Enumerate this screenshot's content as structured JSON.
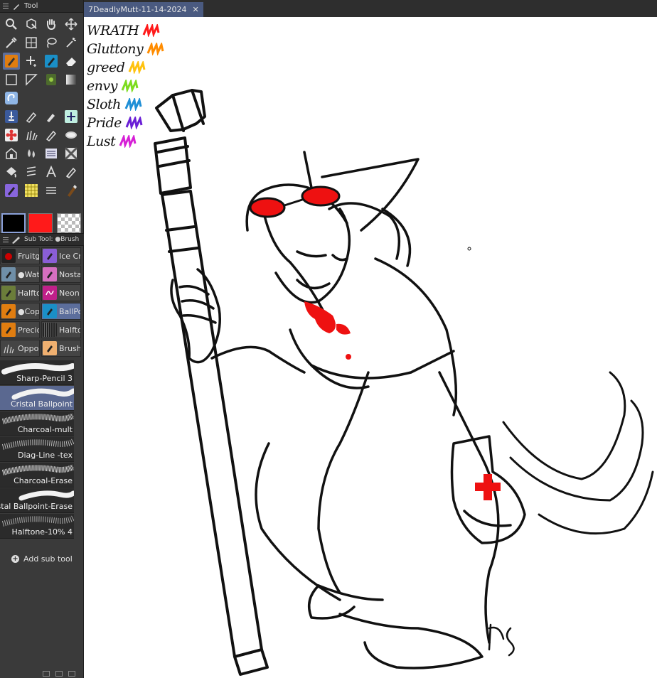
{
  "tool_panel": {
    "title": "Tool"
  },
  "subtool_panel": {
    "title": "Sub Tool: ●Brush"
  },
  "colors": {
    "main": "#000000",
    "sub": "#ff1a1a",
    "accent_orange": "#e07d10",
    "selection": "#5c6e9c"
  },
  "subtool_groups": [
    {
      "label": "Fruitgi",
      "icon": "fruit-brush-icon"
    },
    {
      "label": "Ice Cr",
      "icon": "ice-cream-pen-icon"
    },
    {
      "label": "●Wat",
      "icon": "water-brush-icon"
    },
    {
      "label": "Nosta",
      "icon": "nostalgia-pen-icon"
    },
    {
      "label": "Halfto",
      "icon": "halftone-pen-icon"
    },
    {
      "label": "Neon",
      "icon": "neon-pen-icon"
    },
    {
      "label": "●Copi",
      "icon": "copic-pen-icon"
    },
    {
      "label": "BallPo",
      "icon": "ballpoint-pen-icon",
      "selected": true
    },
    {
      "label": "Precio",
      "icon": "precision-pen-icon"
    },
    {
      "label": "Halfto",
      "icon": "halftone-pattern-icon"
    },
    {
      "label": "Oppor",
      "icon": "grass-brush-icon"
    },
    {
      "label": "Brush",
      "icon": "brush-icon"
    }
  ],
  "brushes": [
    {
      "label": "Sharp-Pencil 3"
    },
    {
      "label": "Cristal Ballpoint",
      "selected": true
    },
    {
      "label": "Charcoal-mult"
    },
    {
      "label": "Diag-Line -tex"
    },
    {
      "label": "Charcoal-Erase"
    },
    {
      "label": "Cristal Ballpoint-Erase"
    },
    {
      "label": "Halftone-10% 4"
    }
  ],
  "add_sub_tool": "Add sub tool",
  "document_tab": {
    "title": "7DeadlyMutt-11-14-2024",
    "close": "✕"
  },
  "sins_legend": [
    {
      "word": "WRATH",
      "color": "#ff1a1a"
    },
    {
      "word": "Gluttony",
      "color": "#ff8c00"
    },
    {
      "word": "greed",
      "color": "#ffc20e"
    },
    {
      "word": "envy",
      "color": "#7ddc1f"
    },
    {
      "word": "Sloth",
      "color": "#1f8fd6"
    },
    {
      "word": "Pride",
      "color": "#6a1fd6"
    },
    {
      "word": "Lust",
      "color": "#d61fd6"
    }
  ]
}
